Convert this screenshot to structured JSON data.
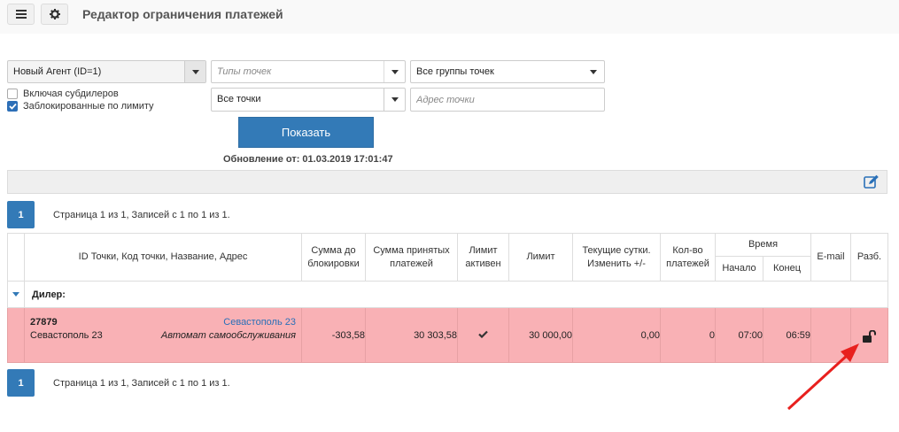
{
  "header": {
    "title": "Редактор ограничения платежей",
    "menu_icon": "hamburger-icon",
    "settings_icon": "gear-icon"
  },
  "filters": {
    "agent": "Новый Агент (ID=1)",
    "point_types_placeholder": "Типы точек",
    "point_groups": "Все группы точек",
    "points": "Все точки",
    "address_placeholder": "Адрес точки",
    "include_subdealers": {
      "label": "Включая субдилеров",
      "checked": false
    },
    "blocked_by_limit": {
      "label": "Заблокированные по лимиту",
      "checked": true
    }
  },
  "show_button": "Показать",
  "update_text": "Обновление от: 01.03.2019 17:01:47",
  "pager": {
    "page": "1",
    "info": "Страница 1 из 1, Записей с 1 по 1 из 1."
  },
  "columns": {
    "point": "ID Точки,  Код точки,  Название,  Адрес",
    "sum_to_block": "Сумма до блокировки",
    "accepted_sum": "Сумма принятых платежей",
    "limit_active": "Лимит активен",
    "limit": "Лимит",
    "current_day": "Текущие сутки. Изменить +/-",
    "payment_count": "Кол-во платежей",
    "time": "Время",
    "time_start": "Начало",
    "time_end": "Конец",
    "email": "E-mail",
    "unblock": "Разб."
  },
  "group": {
    "label": "Дилер:"
  },
  "rows": [
    {
      "point_id": "27879",
      "point_code": "Севастополь 23",
      "name": "Севастополь 23",
      "address": "Автомат самообслуживания",
      "sum_to_block": "-303,58",
      "accepted_sum": "30 303,58",
      "limit_active": true,
      "limit": "30 000,00",
      "current_day": "0,00",
      "payment_count": "0",
      "time_start": "07:00",
      "time_end": "06:59",
      "email": "",
      "unblock_icon": "unlock-icon"
    }
  ],
  "colors": {
    "accent": "#337ab7",
    "blocked_row": "#f9b1b5",
    "arrow": "#e8201e"
  }
}
